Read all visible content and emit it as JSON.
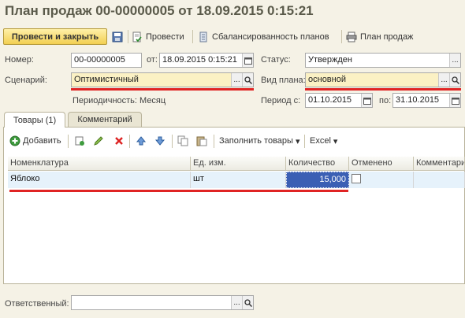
{
  "window": {
    "title": "План продаж 00-00000005 от 18.09.2015 0:15:21"
  },
  "toolbar": {
    "post_and_close": "Провести и закрыть",
    "post": "Провести",
    "balance": "Сбалансированность планов",
    "print": "План продаж"
  },
  "form": {
    "number_label": "Номер:",
    "number_value": "00-00000005",
    "date_label": "от:",
    "date_value": "18.09.2015  0:15:21",
    "status_label": "Статус:",
    "status_value": "Утвержден",
    "scenario_label": "Сценарий:",
    "scenario_value": "Оптимистичный",
    "plan_type_label": "Вид плана:",
    "plan_type_value": "основной",
    "periodicity_text": "Периодичность: Месяц",
    "period_from_label": "Период с:",
    "period_from_value": "01.10.2015",
    "period_to_label": "по:",
    "period_to_value": "31.10.2015",
    "responsible_label": "Ответственный:",
    "responsible_value": ""
  },
  "tabs": [
    {
      "label": "Товары (1)"
    },
    {
      "label": "Комментарий"
    }
  ],
  "table_toolbar": {
    "add": "Добавить",
    "fill_goods": "Заполнить товары",
    "excel": "Excel"
  },
  "table": {
    "columns": [
      "Номенклатура",
      "Ед. изм.",
      "Количество",
      "Отменено",
      "Комментарий"
    ],
    "rows": [
      {
        "item": "Яблоко",
        "unit": "шт",
        "quantity": "15,000",
        "cancelled": false,
        "comment": ""
      }
    ]
  },
  "colors": {
    "accent_red": "#e02424",
    "highlight_field": "#fbf1c4",
    "selected_cell": "#3b5fb4",
    "primary_button": "#f2cf52"
  }
}
